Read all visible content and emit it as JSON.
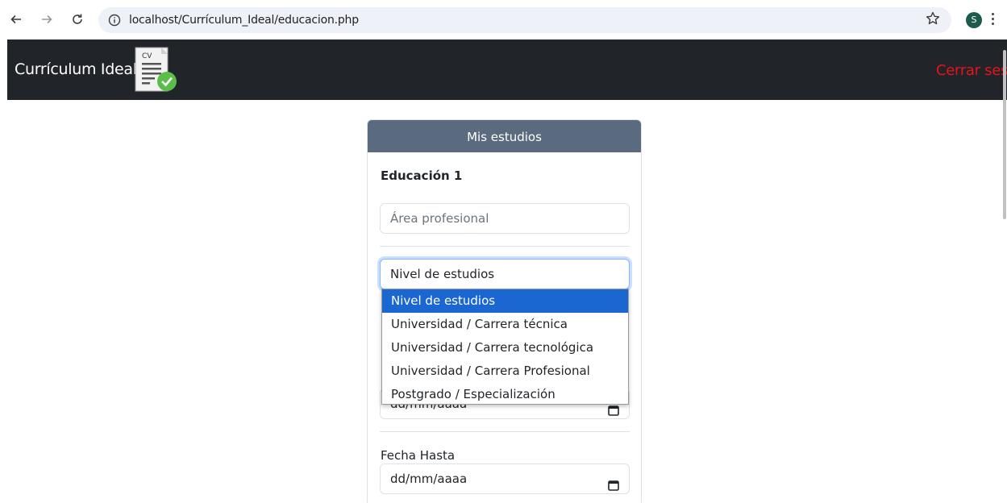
{
  "browser": {
    "url": "localhost/Currículum_Ideal/educacion.php",
    "avatar_letter": "S"
  },
  "navbar": {
    "brand": "Currículum Ideal",
    "logo_text": "CV",
    "logout": "Cerrar sesión",
    "logout_color": "#e8121b"
  },
  "card": {
    "header": "Mis estudios",
    "header_color": "#5b6b7f",
    "section_title": "Educación 1",
    "area_placeholder": "Área profesional",
    "nivel_value": "Nivel de estudios",
    "fecha_desde_value": "dd/mm/aaaa",
    "fecha_hasta_label": "Fecha Hasta",
    "fecha_hasta_value": "dd/mm/aaaa"
  },
  "dropdown": {
    "options": [
      "Nivel de estudios",
      "Universidad / Carrera técnica",
      "Universidad / Carrera tecnológica",
      "Universidad / Carrera Profesional",
      "Postgrado / Especialización"
    ],
    "selected_index": 0,
    "highlight_color": "#1a67d2"
  }
}
